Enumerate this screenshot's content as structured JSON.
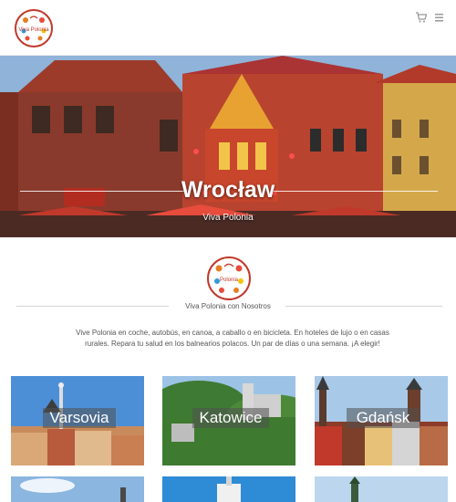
{
  "header": {
    "logo_text": "Viva Polonia",
    "cart_icon": "shopping-cart-icon",
    "menu_icon": "hamburger-menu-icon"
  },
  "hero": {
    "title": "Wrocław",
    "subtitle": "Viva Polonia"
  },
  "about": {
    "logo_text": "Polonia",
    "heading": "Viva Polonia con Nosotros",
    "text": "Vive Polonia en coche, autobús, en canoa, a caballo o en bicicleta. En hoteles de lujo o en casas rurales. Repara tu salud en los balnearios polacos. Un par de días o una semana. ¡A elegir!"
  },
  "destinations": [
    {
      "label": "Varsovia"
    },
    {
      "label": "Katowice"
    },
    {
      "label": "Gdańsk"
    }
  ],
  "colors": {
    "brand_red": "#c0392b",
    "text": "#555555",
    "divider": "#d5d5d5"
  }
}
